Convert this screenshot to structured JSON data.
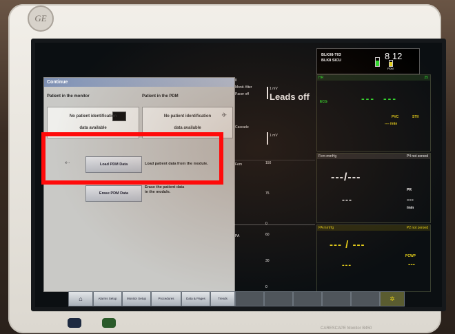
{
  "dialog": {
    "title": "Continue",
    "left_header": "Patient in the monitor",
    "right_header": "Patient in the PDM",
    "left_box_line1": "No patient identification",
    "left_box_line2": "data available",
    "right_box_line1": "No patient identification",
    "right_box_line2": "data available",
    "load_button": "Load PDM Data",
    "load_desc": "Load patient data from the module.",
    "erase_button": "Erase PDM Data",
    "erase_desc_line1": "Erase the patient data",
    "erase_desc_line2": "in the module."
  },
  "waveform": {
    "ii_label": "II",
    "monit_filter": "Monit. filter",
    "pacer": "Pacer off",
    "one_mv": "1 mV",
    "leads_off": "Leads off",
    "cascade": "Cascade",
    "cascade_mv": "1 mV",
    "fem_label": "Fem",
    "fem_150": "150",
    "fem_75": "75",
    "fem_0": "0",
    "pa_label": "PA",
    "pa_60": "60",
    "pa_30": "30",
    "pa_0": "0"
  },
  "status": {
    "bed": "BLK08-T03",
    "unit": "BLK8 SICU",
    "time": "8 12",
    "pdm": "PDM"
  },
  "right_panel": {
    "hr_tile_label": "HR",
    "hr_tile_label2": "25",
    "ecg": "ECG",
    "pvc": "PVC",
    "pvc_units": "---- /min",
    "st_label": "STII",
    "fem_tile": "Fem  mmHg",
    "fem_status": "P4 not zeroed",
    "fem_pr": "PR",
    "fem_pr_units": "/min",
    "pa_tile": "PA  mmHg",
    "pa_status": "P2 not zeroed",
    "pcwp": "PCWP",
    "dashes_big": "---/---",
    "dashes_mid": "---",
    "dash_slash": "--- / ---"
  },
  "bottom_bar": {
    "home": "⌂",
    "alarms": "Alarms Setup",
    "monitor": "Monitor Setup",
    "procedures": "Procedures",
    "data": "Data & Pages",
    "trends": "Trends"
  },
  "bezel": {
    "brand": "GE",
    "model": "CARESCAPE Monitor B450"
  },
  "colors": {
    "accent_green": "#2fe02f",
    "accent_yellow": "#e8d21a",
    "accent_white": "#ffffff",
    "highlight_red": "#ff0a0a"
  }
}
